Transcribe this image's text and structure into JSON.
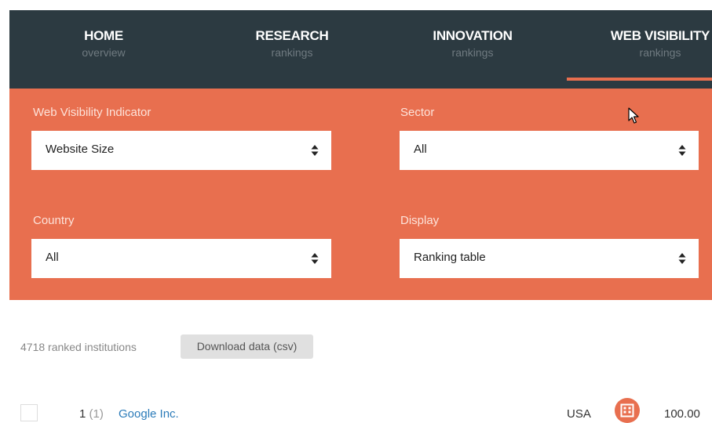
{
  "nav": {
    "items": [
      {
        "title": "HOME",
        "sub": "overview"
      },
      {
        "title": "RESEARCH",
        "sub": "rankings"
      },
      {
        "title": "INNOVATION",
        "sub": "rankings"
      },
      {
        "title": "WEB VISIBILITY",
        "sub": "rankings"
      }
    ],
    "active_index": 3
  },
  "filters": {
    "indicator": {
      "label": "Web Visibility Indicator",
      "value": "Website Size"
    },
    "sector": {
      "label": "Sector",
      "value": "All"
    },
    "country": {
      "label": "Country",
      "value": "All"
    },
    "display": {
      "label": "Display",
      "value": "Ranking table"
    }
  },
  "results": {
    "count_text": "4718 ranked institutions",
    "download_label": "Download data (csv)"
  },
  "rows": [
    {
      "rank": "1",
      "prev_rank": "(1)",
      "name": "Google Inc.",
      "country": "USA",
      "sector_icon": "building-icon",
      "score": "100.00"
    }
  ],
  "colors": {
    "nav_bg": "#2c3a41",
    "accent": "#e86f4f",
    "link": "#2b7bb9"
  }
}
